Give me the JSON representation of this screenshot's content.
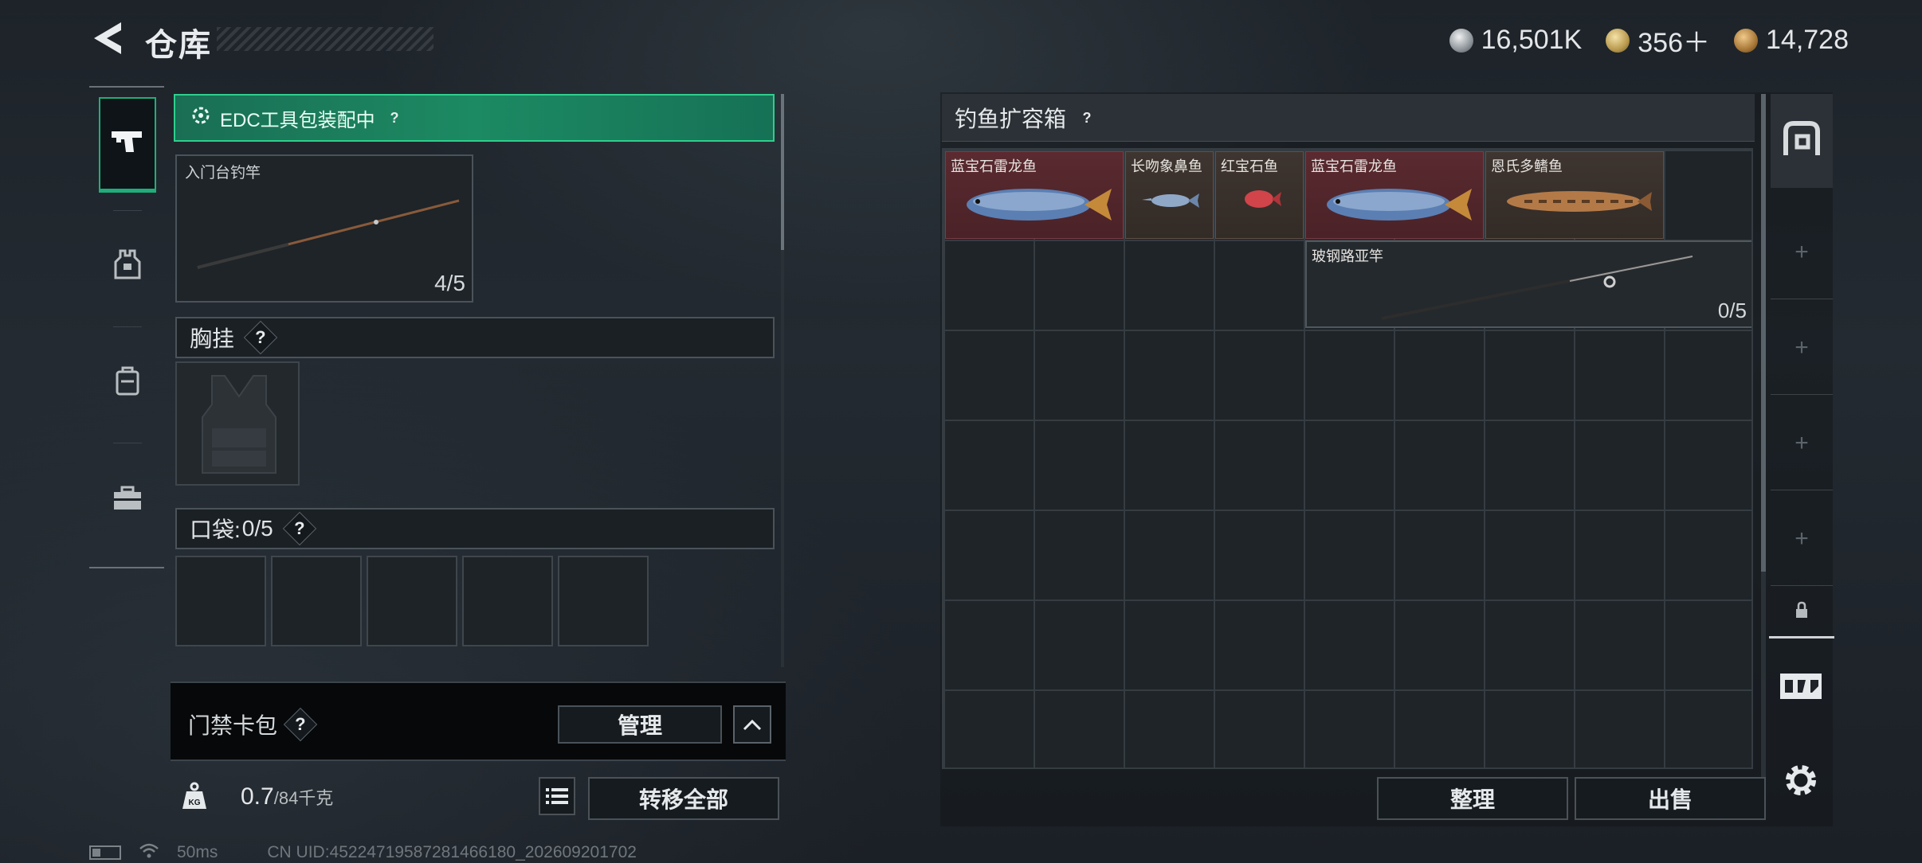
{
  "header": {
    "title": "仓库",
    "currencies": [
      {
        "icon": "silver-coin-icon",
        "value": "16,501K"
      },
      {
        "icon": "gold-triangle-coin-icon",
        "value": "356＋"
      },
      {
        "icon": "bronze-coin-icon",
        "value": "14,728"
      }
    ]
  },
  "tabs": [
    {
      "name": "tab-weapon",
      "icon": "pistol-icon",
      "active": true
    },
    {
      "name": "tab-armor",
      "icon": "armor-vest-icon",
      "active": false
    },
    {
      "name": "tab-backpack",
      "icon": "backpack-icon",
      "active": false
    },
    {
      "name": "tab-toolbox",
      "icon": "toolbox-icon",
      "active": false
    }
  ],
  "left": {
    "edc_banner": "EDC工具包装配中",
    "rod_slot": {
      "name": "入门台钓竿",
      "count": "4/5"
    },
    "vest_section": "胸挂",
    "pocket_section": "口袋:",
    "pocket_count": "0/5",
    "keycard_label": "门禁卡包",
    "manage_label": "管理",
    "weight_value": "0.7",
    "weight_max": "/84千克",
    "transfer_label": "转移全部"
  },
  "right": {
    "title": "钓鱼扩容箱",
    "items": [
      {
        "name": "蓝宝石雷龙鱼",
        "rarity": "red"
      },
      {
        "name": "长吻象鼻鱼",
        "rarity": "tan"
      },
      {
        "name": "红宝石鱼",
        "rarity": "tan"
      },
      {
        "name": "蓝宝石雷龙鱼",
        "rarity": "red"
      },
      {
        "name": "恩氏多鳍鱼",
        "rarity": "tan"
      },
      {
        "name": "玻钢路亚竿",
        "rarity": "rod",
        "count": "0/5"
      }
    ],
    "sort_label": "整理",
    "sell_label": "出售"
  },
  "status": {
    "ping": "50ms",
    "uid": "CN UID:45224719587281466180_202609201702"
  },
  "colors": {
    "accent_green": "#1fae7a",
    "rarity_red": "#5a2a30",
    "rarity_tan": "#3e3530"
  }
}
